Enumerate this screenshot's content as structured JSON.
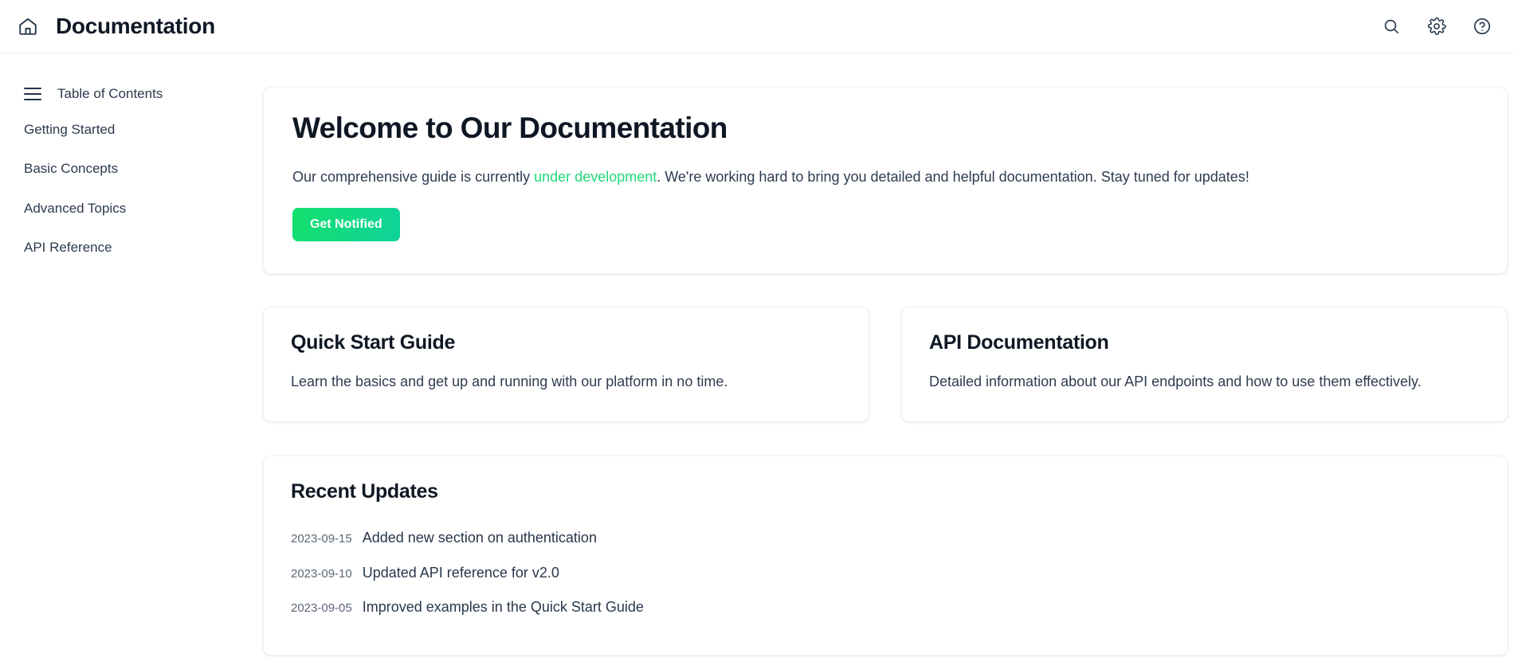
{
  "header": {
    "home_icon": "home-icon",
    "title": "Documentation",
    "actions": [
      {
        "name": "search-icon",
        "label": "Search"
      },
      {
        "name": "gear-icon",
        "label": "Settings"
      },
      {
        "name": "help-icon",
        "label": "Help"
      }
    ]
  },
  "sidebar": {
    "menu_icon": "hamburger-icon",
    "toc_title": "Table of Contents",
    "items": [
      {
        "label": "Getting Started"
      },
      {
        "label": "Basic Concepts"
      },
      {
        "label": "Advanced Topics"
      },
      {
        "label": "API Reference"
      }
    ]
  },
  "hero": {
    "title": "Welcome to Our Documentation",
    "text_before": "Our comprehensive guide is currently ",
    "accent": "under development",
    "text_after": ". We're working hard to bring you detailed and helpful documentation. Stay tuned for updates!",
    "cta_label": "Get Notified"
  },
  "cards": [
    {
      "title": "Quick Start Guide",
      "text": "Learn the basics and get up and running with our platform in no time."
    },
    {
      "title": "API Documentation",
      "text": "Detailed information about our API endpoints and how to use them effectively."
    }
  ],
  "updates": {
    "title": "Recent Updates",
    "items": [
      {
        "date": "2023-09-15",
        "text": "Added new section on authentication"
      },
      {
        "date": "2023-09-10",
        "text": "Updated API reference for v2.0"
      },
      {
        "date": "2023-09-05",
        "text": "Improved examples in the Quick Start Guide"
      }
    ]
  },
  "colors": {
    "accent_green": "#1fd97a",
    "button_gradient_start": "#14e06e",
    "button_gradient_end": "#0fd39a",
    "text_dark": "#0f1724",
    "text_body": "#2e3c50",
    "page_background": "#ffffff"
  }
}
